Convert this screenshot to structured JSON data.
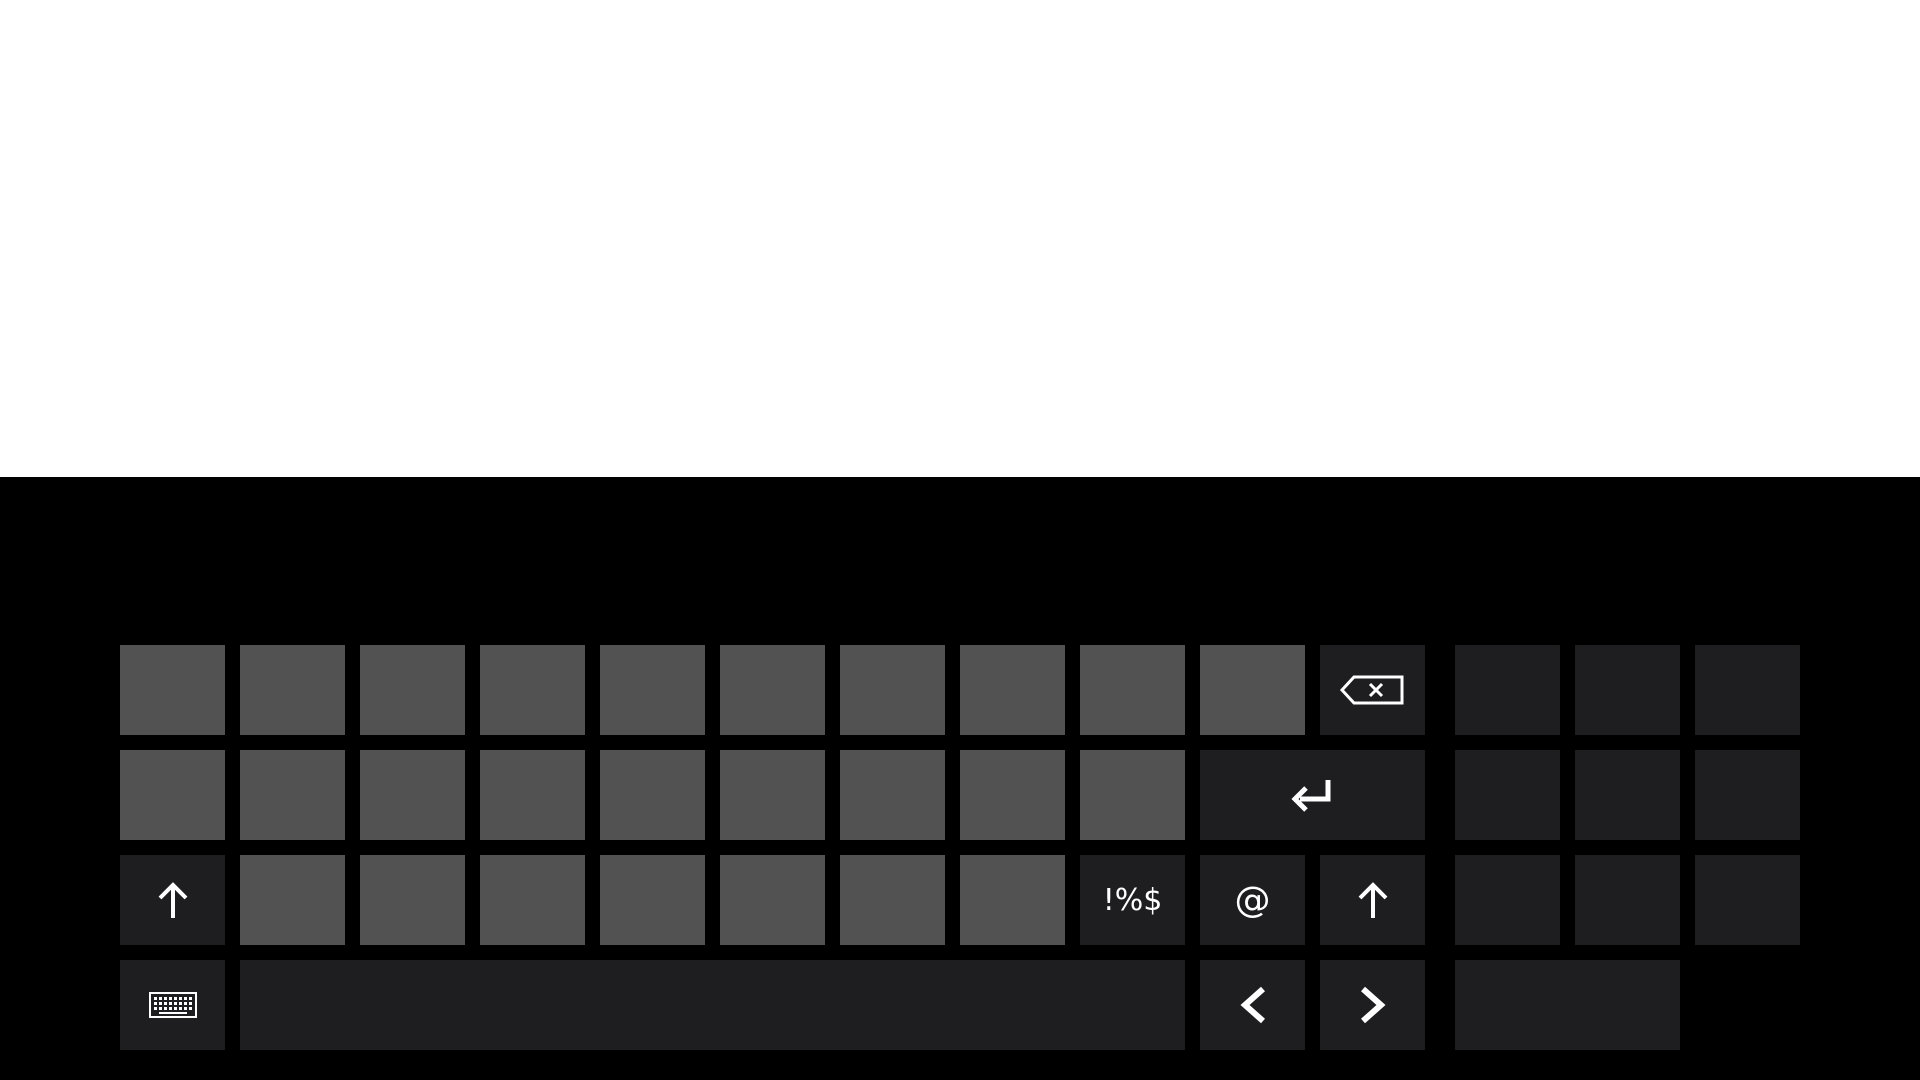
{
  "colors": {
    "screen_background": "#ffffff",
    "keyboard_background": "#000000",
    "letter_key": "#525252",
    "function_key": "#1e1e20",
    "glyph": "#ffffff"
  },
  "keyboard": {
    "symbols_key_label": "!%$",
    "at_key_label": "@",
    "icons": {
      "backspace": "backspace-icon",
      "enter": "enter-icon",
      "shift": "shift-arrow-up-icon",
      "keyboard_layout": "keyboard-icon",
      "left": "chevron-left-icon",
      "right": "chevron-right-icon"
    }
  }
}
